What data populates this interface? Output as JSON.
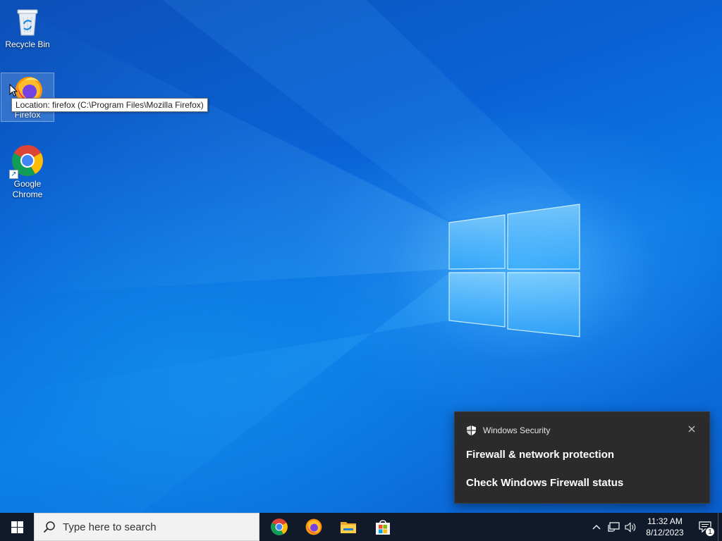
{
  "desktop": {
    "icons": [
      {
        "label": "Recycle Bin",
        "icon": "recycle-bin-icon"
      },
      {
        "label": "Firefox",
        "icon": "firefox-icon"
      },
      {
        "label": "Google Chrome",
        "icon": "chrome-icon"
      }
    ],
    "tooltip": "Location: firefox (C:\\Program Files\\Mozilla Firefox)"
  },
  "toast": {
    "app_name": "Windows Security",
    "title": "Firewall & network protection",
    "body": "Check Windows Firewall status",
    "icon": "shield-icon",
    "background": "#2b2b2b"
  },
  "taskbar": {
    "search_placeholder": "Type here to search",
    "pinned_apps": [
      "chrome-icon",
      "firefox-icon",
      "file-explorer-icon",
      "store-icon"
    ],
    "clock_time": "11:32 AM",
    "clock_date": "8/12/2023",
    "notification_count": "1",
    "background": "#101a2b"
  },
  "colors": {
    "wallpaper_blue": "#0a63d6",
    "accent": "#0078d7"
  }
}
